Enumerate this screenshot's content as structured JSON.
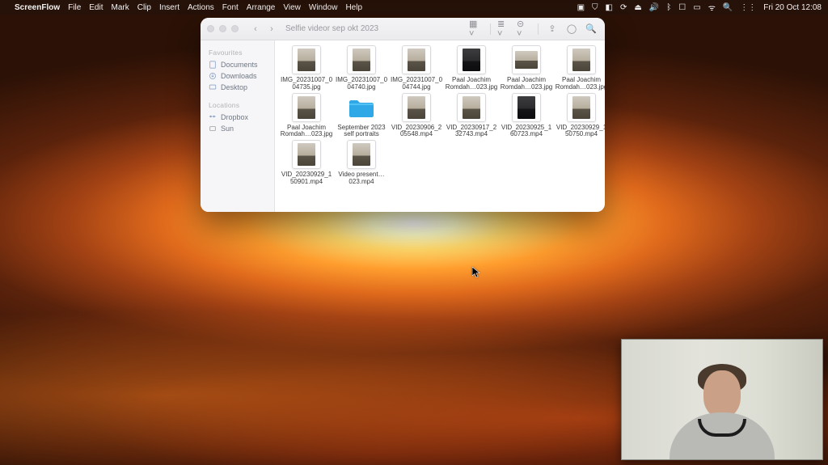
{
  "menubar": {
    "app": "ScreenFlow",
    "items": [
      "File",
      "Edit",
      "Mark",
      "Clip",
      "Insert",
      "Actions",
      "Font",
      "Arrange",
      "View",
      "Window",
      "Help"
    ],
    "clock": "Fri 20 Oct  12:08"
  },
  "finder": {
    "title": "Selfie videor sep okt 2023",
    "sidebar": {
      "favourites_hdr": "Favourites",
      "favourites": [
        "Documents",
        "Downloads",
        "Desktop"
      ],
      "locations_hdr": "Locations",
      "locations": [
        "Dropbox",
        "Sun"
      ]
    },
    "files": [
      {
        "name": "IMG_20231007_004735.jpg",
        "kind": "img",
        "variant": "light"
      },
      {
        "name": "IMG_20231007_004740.jpg",
        "kind": "img",
        "variant": "light"
      },
      {
        "name": "IMG_20231007_004744.jpg",
        "kind": "img",
        "variant": "light"
      },
      {
        "name": "Paal Joachim Romdah…023.jpg",
        "kind": "img",
        "variant": "dark"
      },
      {
        "name": "Paal Joachim Romdah…023.jpg",
        "kind": "img",
        "variant": "side"
      },
      {
        "name": "Paal Joachim Romdah…023.jpg",
        "kind": "img",
        "variant": "light"
      },
      {
        "name": "Paal Joachim Romdah…023.jpg",
        "kind": "img",
        "variant": "light"
      },
      {
        "name": "September 2023 self portraits",
        "kind": "folder"
      },
      {
        "name": "VID_20230906_205548.mp4",
        "kind": "vid",
        "variant": "light"
      },
      {
        "name": "VID_20230917_232743.mp4",
        "kind": "vid",
        "variant": "light"
      },
      {
        "name": "VID_20230925_160723.mp4",
        "kind": "vid",
        "variant": "dark"
      },
      {
        "name": "VID_20230929_150750.mp4",
        "kind": "vid",
        "variant": "light"
      },
      {
        "name": "VID_20230929_150901.mp4",
        "kind": "vid",
        "variant": "light"
      },
      {
        "name": "Video present…023.mp4",
        "kind": "vid",
        "variant": "light"
      }
    ]
  }
}
